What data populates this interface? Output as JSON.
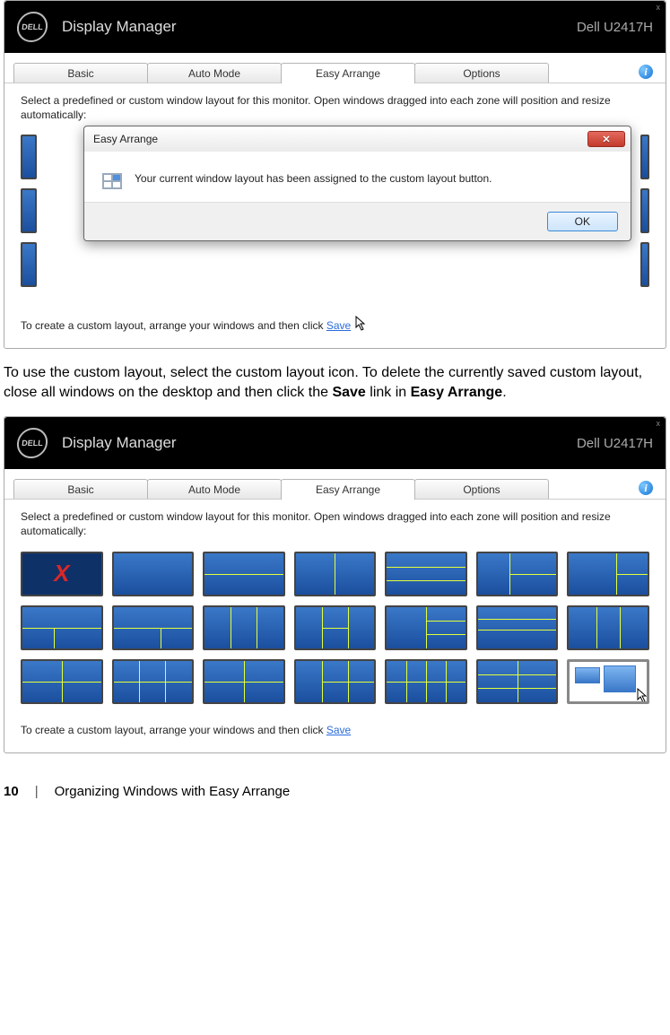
{
  "app": {
    "title": "Display Manager",
    "logo_text": "DELL",
    "monitor": "Dell U2417H",
    "close_glyph": "x"
  },
  "tabs": {
    "basic": "Basic",
    "auto_mode": "Auto Mode",
    "easy_arrange": "Easy Arrange",
    "options": "Options"
  },
  "info_glyph": "i",
  "instructions": {
    "top": "Select a predefined or custom window layout for this monitor. Open windows dragged into each zone will position and resize automatically:",
    "bottom_prefix": "To create a custom layout, arrange your windows and then click ",
    "save_link": "Save"
  },
  "dialog": {
    "title": "Easy Arrange",
    "message": "Your current window layout has been assigned to the custom layout button.",
    "ok": "OK",
    "close_glyph": "✕"
  },
  "none_glyph": "X",
  "doc_paragraph": {
    "t1": "To use the custom layout, select the custom layout icon. To delete the currently saved custom layout, close all windows on the desktop and then click the ",
    "save": "Save",
    "t2": " link in ",
    "ea": "Easy Arrange",
    "t3": "."
  },
  "footer": {
    "page": "10",
    "sep": "|",
    "section": "Organizing Windows with Easy Arrange"
  }
}
